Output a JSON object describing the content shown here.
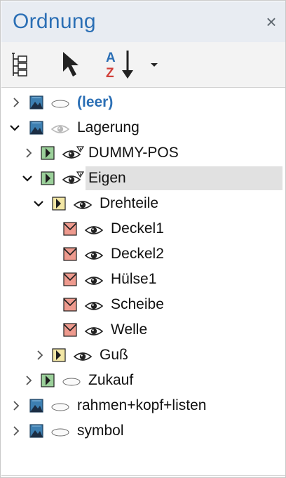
{
  "panel": {
    "title": "Ordnung",
    "close_glyph": "×",
    "accent_color": "#2b6fb5"
  },
  "toolbar": {
    "buttons": [
      {
        "name": "tree-structure-icon",
        "kind": "icon"
      },
      {
        "name": "select-arrow-icon",
        "kind": "icon"
      },
      {
        "name": "sort-az-icon",
        "kind": "icon",
        "text_top": "A",
        "text_bottom": "Z"
      },
      {
        "name": "dropdown-caret-icon",
        "kind": "icon"
      }
    ]
  },
  "tree": {
    "nodes": [
      {
        "label": "(leer)",
        "expand": "collapsed",
        "icon": "layer-blue",
        "vis": "oval",
        "highlight": true
      },
      {
        "label": "Lagerung",
        "expand": "expanded",
        "icon": "layer-blue",
        "vis": "eye-faded"
      },
      {
        "label": "DUMMY-POS",
        "expand": "collapsed",
        "icon": "group-green",
        "vis": "eye-pin"
      },
      {
        "label": "Eigen",
        "expand": "expanded",
        "icon": "group-green",
        "vis": "eye-pin",
        "selected": true
      },
      {
        "label": "Drehteile",
        "expand": "expanded",
        "icon": "group-yellow",
        "vis": "eye"
      },
      {
        "label": "Deckel1",
        "expand": "none",
        "icon": "part-red",
        "vis": "eye"
      },
      {
        "label": "Deckel2",
        "expand": "none",
        "icon": "part-red",
        "vis": "eye"
      },
      {
        "label": "Hülse1",
        "expand": "none",
        "icon": "part-red",
        "vis": "eye"
      },
      {
        "label": "Scheibe",
        "expand": "none",
        "icon": "part-red",
        "vis": "eye"
      },
      {
        "label": "Welle",
        "expand": "none",
        "icon": "part-red",
        "vis": "eye"
      },
      {
        "label": "Guß",
        "expand": "collapsed",
        "icon": "group-yellow",
        "vis": "eye"
      },
      {
        "label": "Zukauf",
        "expand": "collapsed",
        "icon": "group-green",
        "vis": "oval"
      },
      {
        "label": "rahmen+kopf+listen",
        "expand": "collapsed",
        "icon": "layer-blue",
        "vis": "oval"
      },
      {
        "label": "symbol",
        "expand": "collapsed",
        "icon": "layer-blue",
        "vis": "oval"
      }
    ]
  }
}
